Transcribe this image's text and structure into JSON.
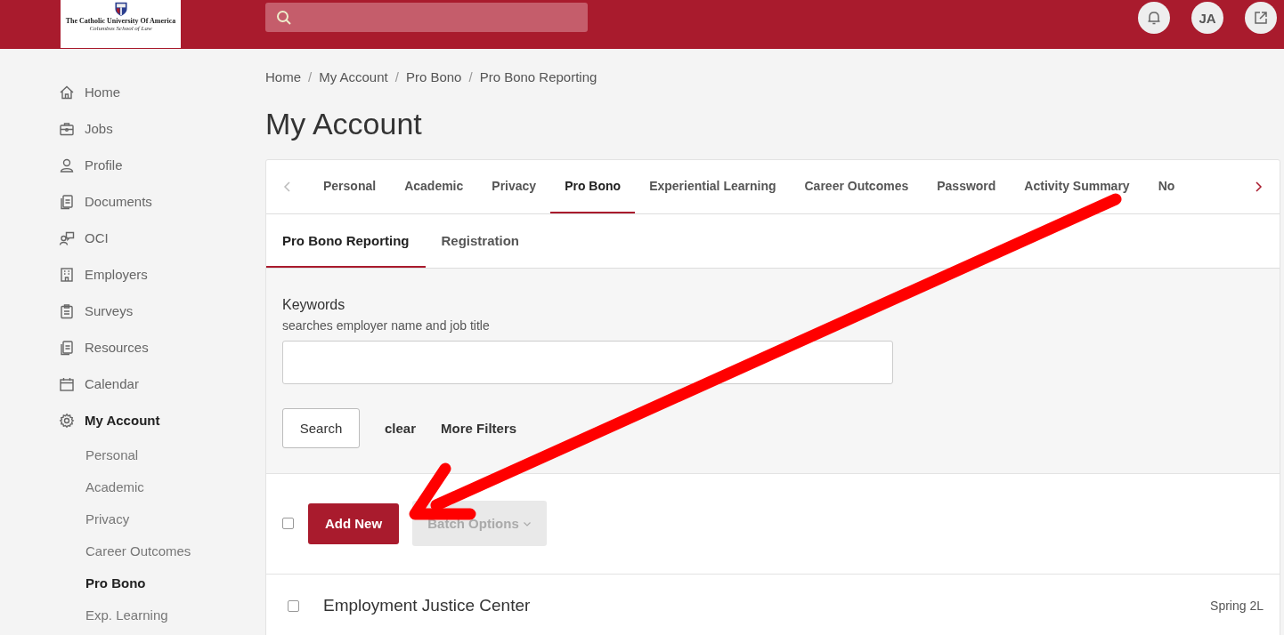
{
  "header": {
    "logo": {
      "name": "The Catholic University Of America",
      "subtitle": "Columbus School of Law"
    },
    "avatar": "JA"
  },
  "sidebar": {
    "items": [
      {
        "label": "Home",
        "selected": false
      },
      {
        "label": "Jobs",
        "selected": false
      },
      {
        "label": "Profile",
        "selected": false
      },
      {
        "label": "Documents",
        "selected": false
      },
      {
        "label": "OCI",
        "selected": false
      },
      {
        "label": "Employers",
        "selected": false
      },
      {
        "label": "Surveys",
        "selected": false
      },
      {
        "label": "Resources",
        "selected": false
      },
      {
        "label": "Calendar",
        "selected": false
      },
      {
        "label": "My Account",
        "selected": true,
        "children": [
          {
            "label": "Personal",
            "selected": false
          },
          {
            "label": "Academic",
            "selected": false
          },
          {
            "label": "Privacy",
            "selected": false
          },
          {
            "label": "Career Outcomes",
            "selected": false
          },
          {
            "label": "Pro Bono",
            "selected": true
          },
          {
            "label": "Exp. Learning",
            "selected": false
          }
        ]
      }
    ]
  },
  "breadcrumb": {
    "separator": "/",
    "items": [
      "Home",
      "My Account",
      "Pro Bono",
      "Pro Bono Reporting"
    ]
  },
  "page_title": "My Account",
  "tabs": [
    {
      "label": "Personal",
      "selected": false
    },
    {
      "label": "Academic",
      "selected": false
    },
    {
      "label": "Privacy",
      "selected": false
    },
    {
      "label": "Pro Bono",
      "selected": true
    },
    {
      "label": "Experiential Learning",
      "selected": false
    },
    {
      "label": "Career Outcomes",
      "selected": false
    },
    {
      "label": "Password",
      "selected": false
    },
    {
      "label": "Activity Summary",
      "selected": false
    },
    {
      "label": "No",
      "selected": false
    }
  ],
  "subtabs": [
    {
      "label": "Pro Bono Reporting",
      "selected": true
    },
    {
      "label": "Registration",
      "selected": false
    }
  ],
  "filters": {
    "label": "Keywords",
    "hint": "searches employer name and job title",
    "search_button": "Search",
    "clear_link": "clear",
    "more_filters_link": "More Filters"
  },
  "actions": {
    "select_all_checked": false,
    "add_new": "Add New",
    "batch_options": {
      "label": "Batch Options",
      "disabled": true
    }
  },
  "rows": [
    {
      "title": "Employment Justice Center",
      "term": "Spring 2L",
      "checked": false
    }
  ]
}
